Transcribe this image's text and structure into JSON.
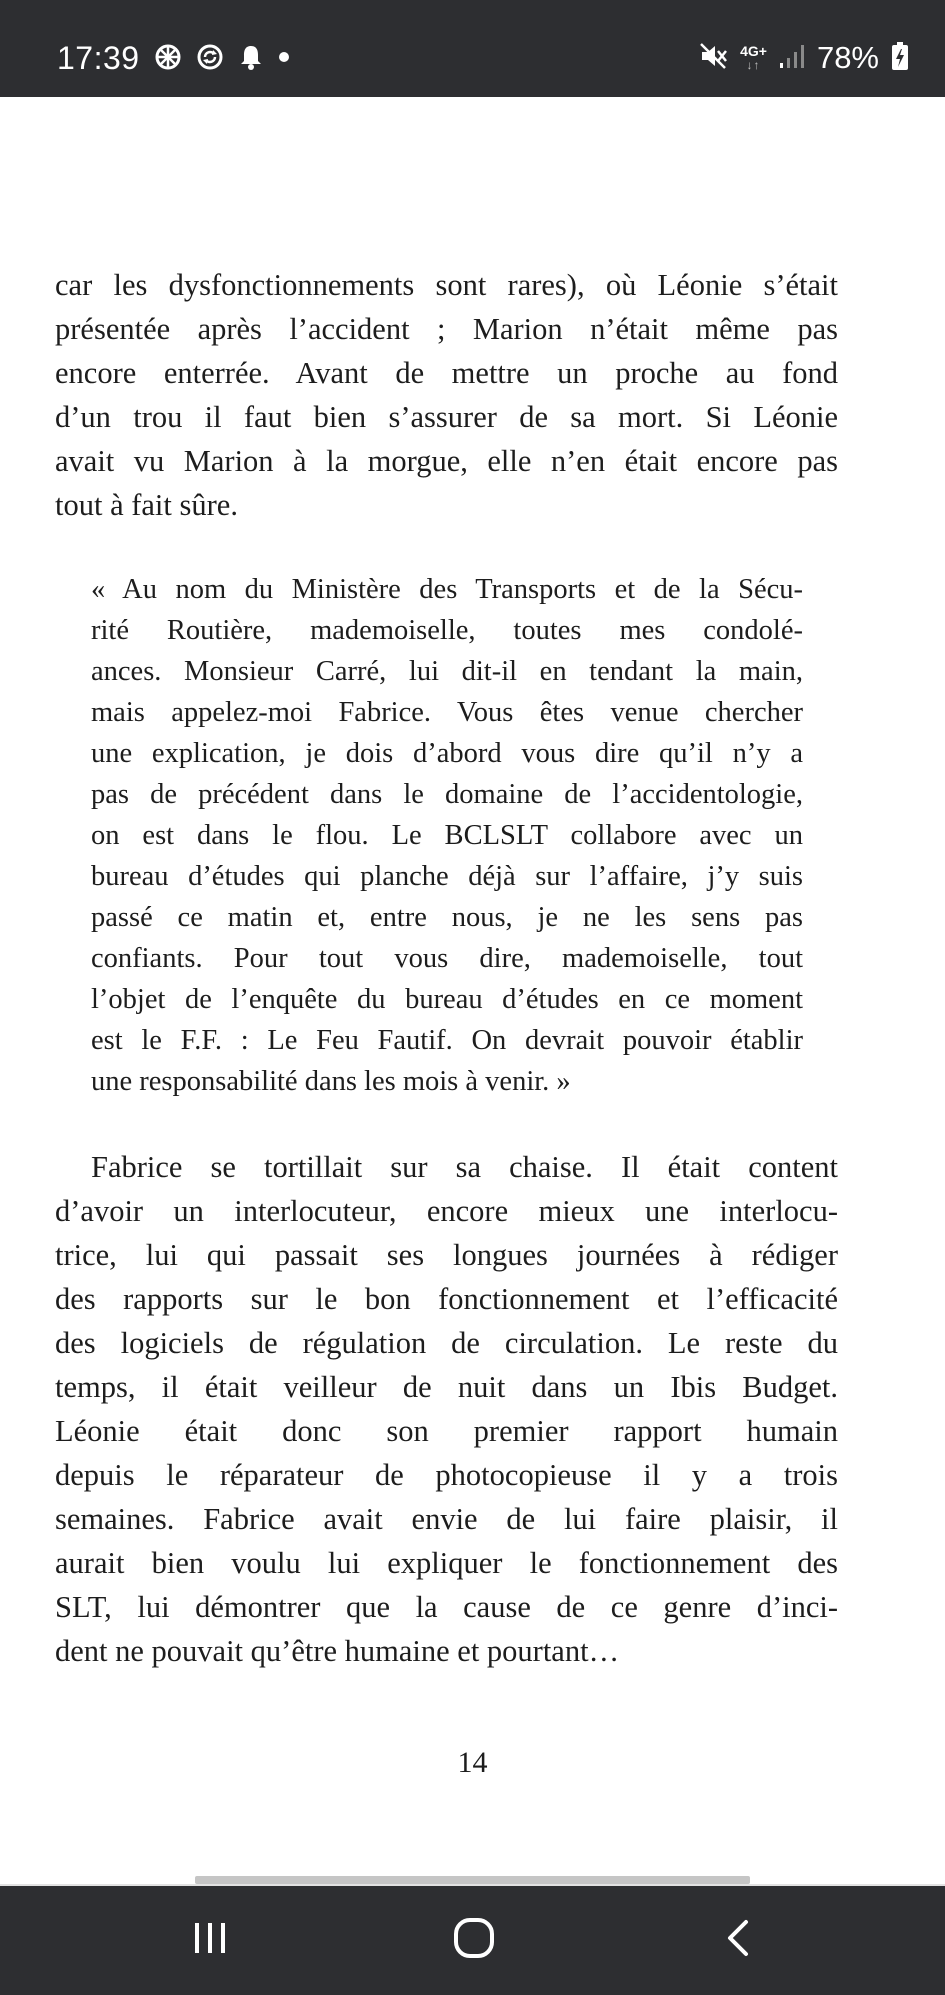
{
  "status_bar": {
    "time": "17:39",
    "network_label": "4G+",
    "network_arrows": "↓↑",
    "battery": "78%",
    "icons_left": [
      "settings-wheel-icon",
      "sync-icon",
      "notification-bell-icon",
      "dot-icon"
    ],
    "icons_right": [
      "mute-icon",
      "network-4g-icon",
      "signal-icon",
      "battery-charging-icon"
    ]
  },
  "page": {
    "paragraph_1": [
      "car les dysfonctionnements sont rares), où Léonie s’était",
      "présentée après l’accident ; Marion n’était même pas",
      "encore enterrée. Avant de mettre un proche au fond",
      "d’un trou il faut bien s’assurer de sa mort. Si Léonie",
      "avait vu Marion à la morgue, elle n’en était encore pas",
      "tout à fait sûre."
    ],
    "quote": [
      "« Au nom du Ministère des Transports et de la Sécu-",
      "rité Routière, mademoiselle, toutes mes condolé-",
      "ances. Monsieur Carré, lui dit-il en tendant la main,",
      "mais appelez-moi Fabrice. Vous êtes venue chercher",
      "une explication, je dois d’abord vous dire qu’il n’y a",
      "pas de précédent dans le domaine de l’accidentologie,",
      "on est dans le flou. Le BCLSLT collabore avec un",
      "bureau d’études qui planche déjà sur l’affaire, j’y suis",
      "passé ce matin et, entre nous, je ne les sens pas",
      "confiants. Pour tout vous dire, mademoiselle, tout",
      "l’objet de l’enquête du bureau d’études en ce moment",
      "est le F.F. : Le Feu Fautif. On devrait pouvoir établir",
      "une responsabilité dans les mois à venir. »"
    ],
    "paragraph_2": [
      "Fabrice se tortillait sur sa chaise. Il était content",
      "d’avoir un interlocuteur, encore mieux une interlocu-",
      "trice, lui qui passait ses longues journées à rédiger",
      "des rapports sur le bon fonctionnement et l’efficacité",
      "des logiciels de régulation de circulation. Le reste du",
      "temps, il était veilleur de nuit dans un Ibis Budget.",
      "Léonie était donc son premier rapport humain",
      "depuis le réparateur de photocopieuse il y a trois",
      "semaines. Fabrice avait envie de lui faire plaisir, il",
      "aurait bien voulu lui expliquer le fonctionnement des",
      "SLT, lui démontrer que la cause de ce genre d’inci-",
      "dent ne pouvait qu’être humaine et pourtant…"
    ],
    "page_number": "14"
  },
  "nav_bar": {
    "buttons": [
      "recent-apps-icon",
      "home-icon",
      "back-icon"
    ]
  }
}
